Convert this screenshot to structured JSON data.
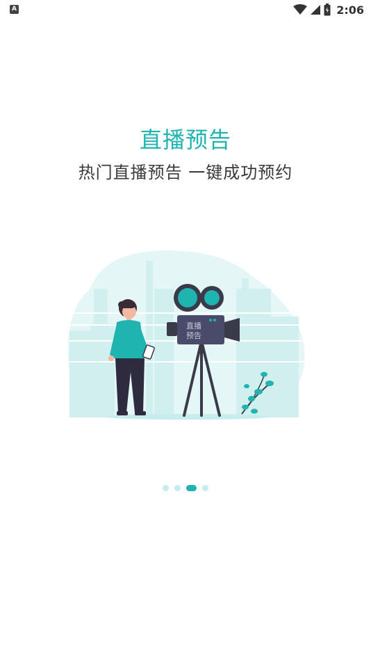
{
  "status_bar": {
    "notification_icon": "A",
    "time": "2:06",
    "icons": [
      "wifi-icon",
      "signal-icon",
      "battery-icon"
    ]
  },
  "onboarding": {
    "title": "直播预告",
    "subtitle": "热门直播预告 一键成功预约",
    "camera_label_line1": "直播",
    "camera_label_line2": "预告"
  },
  "pager": {
    "total": 4,
    "active_index": 2
  },
  "colors": {
    "accent": "#1fb4b0",
    "subtitle_text": "#3a3a3a",
    "dot_inactive": "#c6ecee",
    "camera_body": "#4a4a6a"
  }
}
